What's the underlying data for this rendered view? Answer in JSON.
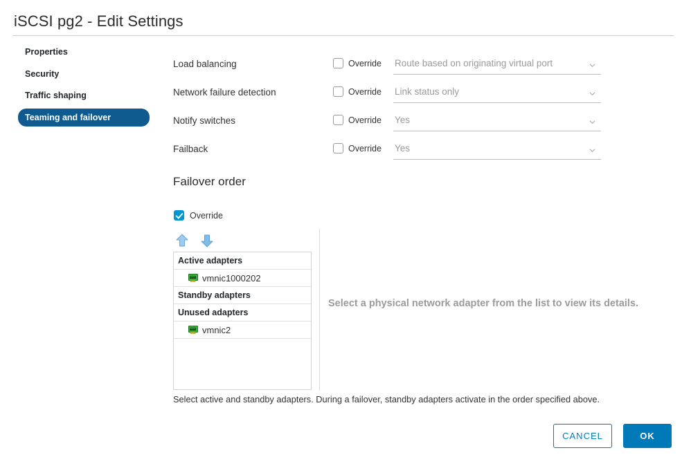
{
  "dialog": {
    "title": "iSCSI pg2 - Edit Settings"
  },
  "sidebar": {
    "items": [
      {
        "label": "Properties",
        "active": false
      },
      {
        "label": "Security",
        "active": false
      },
      {
        "label": "Traffic shaping",
        "active": false
      },
      {
        "label": "Teaming and failover",
        "active": true
      }
    ]
  },
  "form": {
    "override_label": "Override",
    "rows": [
      {
        "label": "Load balancing",
        "override_checked": false,
        "value": "Route based on originating virtual port"
      },
      {
        "label": "Network failure detection",
        "override_checked": false,
        "value": "Link status only"
      },
      {
        "label": "Notify switches",
        "override_checked": false,
        "value": "Yes"
      },
      {
        "label": "Failback",
        "override_checked": false,
        "value": "Yes"
      }
    ]
  },
  "failover": {
    "heading": "Failover order",
    "override_label": "Override",
    "override_checked": true,
    "move_up_tooltip": "Move up",
    "move_down_tooltip": "Move down",
    "list": [
      {
        "type": "group",
        "label": "Active adapters"
      },
      {
        "type": "item",
        "label": "vmnic1000202",
        "icon": "network-adapter-icon"
      },
      {
        "type": "group",
        "label": "Standby adapters"
      },
      {
        "type": "group",
        "label": "Unused adapters"
      },
      {
        "type": "item",
        "label": "vmnic2",
        "icon": "network-adapter-icon"
      }
    ],
    "detail_placeholder": "Select a physical network adapter from the list to view its details.",
    "hint": "Select active and standby adapters. During a failover, standby adapters activate in the order specified above."
  },
  "footer": {
    "cancel_label": "CANCEL",
    "ok_label": "OK"
  },
  "colors": {
    "accent": "#0079b8",
    "checkbox_checked": "#0095d3",
    "nav_active": "#0f5a8f",
    "arrow": "#93c8ea",
    "muted_text": "#9a9a9a"
  }
}
